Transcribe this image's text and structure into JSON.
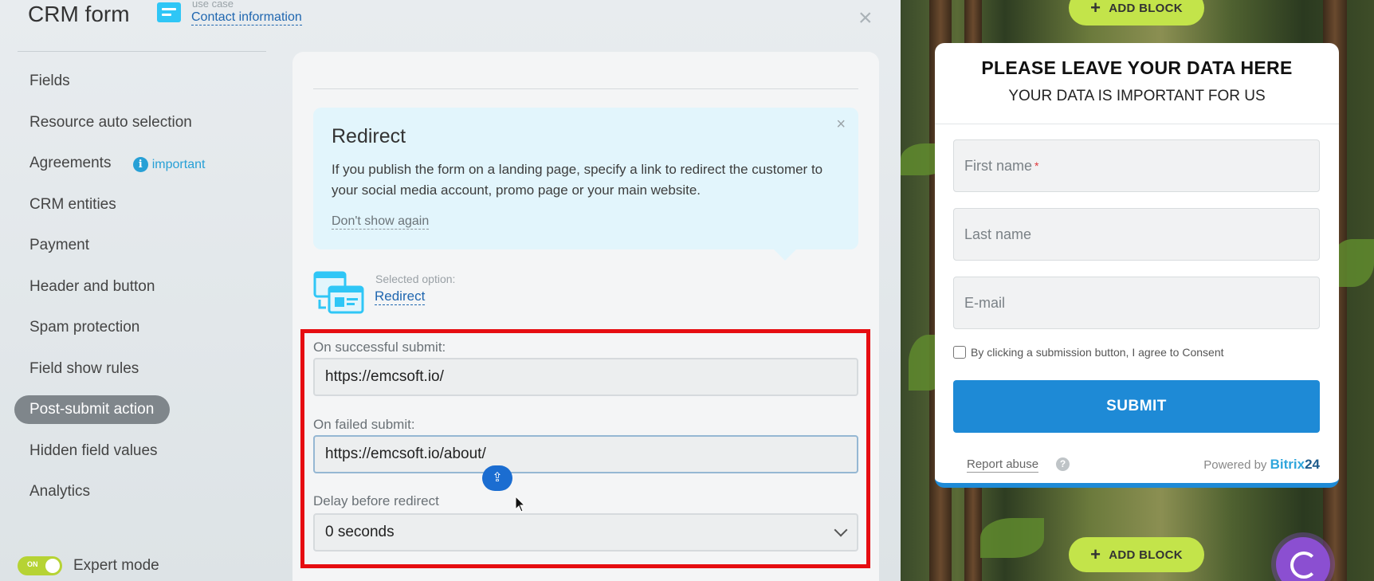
{
  "header": {
    "title": "CRM form",
    "usecase_label": "use case",
    "usecase_value": "Contact information",
    "close_glyph": "×"
  },
  "sidebar": {
    "items": [
      {
        "label": "Fields"
      },
      {
        "label": "Resource auto selection"
      },
      {
        "label": "Agreements",
        "badge": "important"
      },
      {
        "label": "CRM entities"
      },
      {
        "label": "Payment"
      },
      {
        "label": "Header and button"
      },
      {
        "label": "Spam protection"
      },
      {
        "label": "Field show rules"
      },
      {
        "label": "Post-submit action",
        "active": true
      },
      {
        "label": "Hidden field values"
      },
      {
        "label": "Analytics"
      }
    ],
    "expert_mode": {
      "toggle_text": "ON",
      "label": "Expert mode",
      "enabled": true
    }
  },
  "tip": {
    "title": "Redirect",
    "text": "If you publish the form on a landing page, specify a link to redirect the customer to your social media account, promo page or your main website.",
    "dont_show": "Don't show again",
    "close_glyph": "×"
  },
  "selected_option": {
    "label": "Selected option:",
    "value": "Redirect"
  },
  "settings": {
    "success_label": "On successful submit:",
    "success_value": "https://emcsoft.io/",
    "failed_label": "On failed submit:",
    "failed_value": "https://emcsoft.io/about/",
    "delay_label": "Delay before redirect",
    "delay_value": "0 seconds"
  },
  "preview": {
    "add_block_label": "ADD BLOCK",
    "form_title": "PLEASE LEAVE YOUR DATA HERE",
    "form_subtitle": "YOUR DATA IS IMPORTANT FOR US",
    "first_name": "First name",
    "required_mark": "*",
    "last_name": "Last name",
    "email": "E-mail",
    "consent": "By clicking a submission button, I agree to Consent",
    "submit": "SUBMIT",
    "report_abuse": "Report abuse",
    "help_glyph": "?",
    "powered_by": "Powered by",
    "brand_name": "Bitrix",
    "brand_num": "24"
  },
  "colors": {
    "accent": "#1e8ad6",
    "highlight_box": "#e60d11",
    "add_block": "#c3e44a",
    "active_nav": "#7f868b"
  },
  "icons": {
    "usecase": "form-icon",
    "info": "info-icon",
    "close": "close-icon",
    "redirect": "redirect-windows-icon",
    "chevron": "chevron-down-icon",
    "drag": "drag-handle-icon",
    "chat": "chat-widget-icon"
  }
}
